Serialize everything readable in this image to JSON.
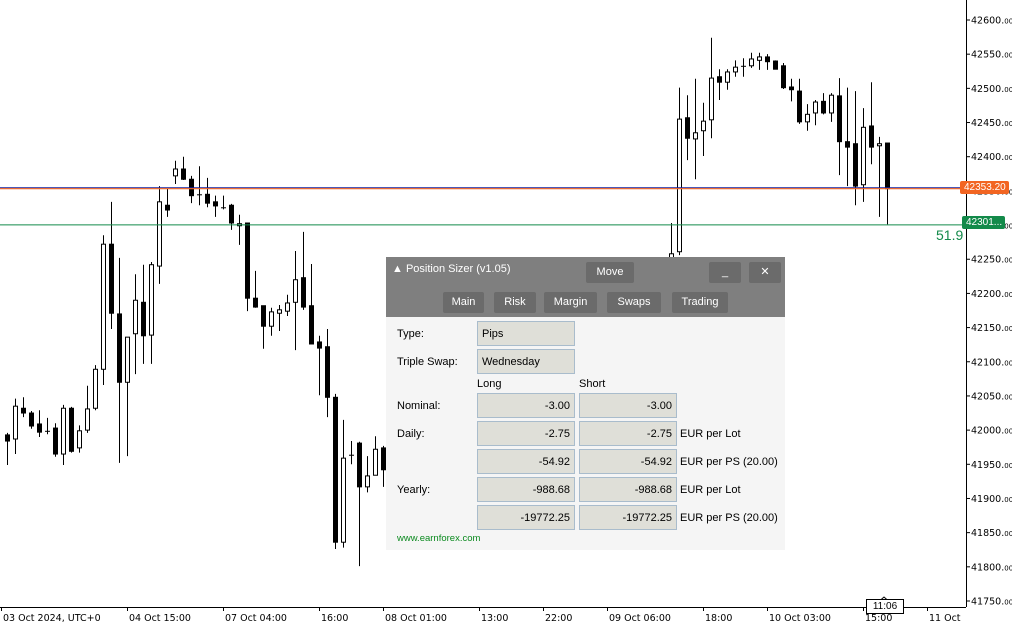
{
  "chart_data": {
    "type": "candlestick",
    "title": "",
    "ylim": [
      41740,
      42630
    ],
    "y_ticks": [
      "42600.00",
      "42550.00",
      "42500.00",
      "42450.00",
      "42400.00",
      "42350.00",
      "42300.00",
      "42250.00",
      "42200.00",
      "42150.00",
      "42100.00",
      "42050.00",
      "42000.00",
      "41950.00",
      "41900.00",
      "41850.00",
      "41800.00",
      "41750.00"
    ],
    "x_tick_labels": [
      "03 Oct 2024, UTC+0",
      "04 Oct 15:00",
      "07 Oct 04:00",
      "16:00",
      "08 Oct 01:00",
      "13:00",
      "22:00",
      "09 Oct 06:00",
      "18:00",
      "10 Oct 03:00",
      "15:00",
      "11 Oct"
    ],
    "candle_fields": [
      "open",
      "high",
      "low",
      "close"
    ],
    "bull_color": "#ffffff",
    "bear_color": "#000000",
    "candles": [
      [
        41993,
        41996,
        41949,
        41984
      ],
      [
        41987,
        42046,
        41965,
        42035
      ],
      [
        42032,
        42048,
        42019,
        42025
      ],
      [
        42025,
        42028,
        42002,
        42006
      ],
      [
        42009,
        42029,
        41990,
        41997
      ],
      [
        41999,
        42018,
        41994,
        41999
      ],
      [
        42003,
        42010,
        41961,
        41965
      ],
      [
        41965,
        42037,
        41949,
        42032
      ],
      [
        42032,
        42034,
        41967,
        41969
      ],
      [
        41974,
        42007,
        41967,
        41999
      ],
      [
        42000,
        42065,
        41996,
        42031
      ],
      [
        42032,
        42095,
        42029,
        42089
      ],
      [
        42089,
        42285,
        42066,
        42272
      ],
      [
        42272,
        42334,
        42148,
        42171
      ],
      [
        42170,
        42252,
        41952,
        42070
      ],
      [
        42070,
        42136,
        41962,
        42136
      ],
      [
        42141,
        42228,
        42082,
        42190
      ],
      [
        42187,
        42242,
        42097,
        42138
      ],
      [
        42139,
        42246,
        42097,
        42242
      ],
      [
        42240,
        42357,
        42214,
        42334
      ],
      [
        42329,
        42353,
        42312,
        42322
      ],
      [
        42372,
        42394,
        42360,
        42382
      ],
      [
        42382,
        42400,
        42366,
        42367
      ],
      [
        42367,
        42372,
        42332,
        42343
      ],
      [
        42345,
        42386,
        42329,
        42345
      ],
      [
        42345,
        42369,
        42326,
        42332
      ],
      [
        42334,
        42343,
        42312,
        42328
      ],
      [
        42326,
        42343,
        42323,
        42326
      ],
      [
        42329,
        42331,
        42293,
        42303
      ],
      [
        42299,
        42315,
        42271,
        42302
      ],
      [
        42303,
        42303,
        42174,
        42193
      ],
      [
        42193,
        42233,
        42179,
        42180
      ],
      [
        42182,
        42182,
        42119,
        42152
      ],
      [
        42152,
        42179,
        42138,
        42173
      ],
      [
        42171,
        42183,
        42145,
        42176
      ],
      [
        42174,
        42198,
        42167,
        42186
      ],
      [
        42187,
        42262,
        42117,
        42220
      ],
      [
        42223,
        42290,
        42176,
        42180
      ],
      [
        42182,
        42243,
        42126,
        42126
      ],
      [
        42129,
        42138,
        42051,
        42120
      ],
      [
        42122,
        42148,
        42019,
        42048
      ],
      [
        42048,
        42053,
        41826,
        41836
      ],
      [
        41836,
        42015,
        41828,
        41959
      ],
      [
        41964,
        41984,
        41950,
        41964
      ],
      [
        41981,
        41983,
        41801,
        41917
      ],
      [
        41917,
        41962,
        41909,
        41933
      ],
      [
        41934,
        41991,
        41934,
        41972
      ],
      [
        41974,
        41977,
        41917,
        41942
      ],
      null,
      null,
      null,
      null,
      null,
      null,
      null,
      null,
      null,
      null,
      null,
      null,
      null,
      null,
      null,
      null,
      null,
      null,
      null,
      null,
      null,
      null,
      null,
      null,
      null,
      null,
      null,
      null,
      null,
      null,
      null,
      null,
      null,
      null,
      null,
      [
        42246,
        42303,
        42242,
        42258
      ],
      [
        42261,
        42501,
        42256,
        42455
      ],
      [
        42457,
        42490,
        42395,
        42427
      ],
      [
        42426,
        42514,
        42367,
        42435
      ],
      [
        42438,
        42479,
        42401,
        42452
      ],
      [
        42454,
        42574,
        42427,
        42515
      ],
      [
        42517,
        42528,
        42483,
        42509
      ],
      [
        42509,
        42528,
        42498,
        42524
      ],
      [
        42524,
        42541,
        42517,
        42531
      ],
      [
        42533,
        42544,
        42517,
        42533
      ],
      [
        42533,
        42552,
        42530,
        42543
      ],
      [
        42541,
        42552,
        42527,
        42546
      ],
      [
        42546,
        42550,
        42527,
        42539
      ],
      [
        42540,
        42541,
        42528,
        42528
      ],
      [
        42533,
        42537,
        42499,
        42501
      ],
      [
        42502,
        42514,
        42481,
        42498
      ],
      [
        42496,
        42514,
        42448,
        42451
      ],
      [
        42451,
        42477,
        42438,
        42462
      ],
      [
        42464,
        42483,
        42446,
        42480
      ],
      [
        42481,
        42493,
        42462,
        42464
      ],
      [
        42464,
        42493,
        42451,
        42490
      ],
      [
        42489,
        42515,
        42373,
        42422
      ],
      [
        42422,
        42501,
        42357,
        42414
      ],
      [
        42419,
        42496,
        42329,
        42357
      ],
      [
        42359,
        42471,
        42334,
        42443
      ],
      [
        42445,
        42509,
        42389,
        42414
      ],
      [
        42416,
        42429,
        42312,
        42419
      ],
      [
        42420,
        42420,
        42301,
        42353.2
      ]
    ],
    "price_lines": [
      {
        "price": 42353.2,
        "label": "42353.20",
        "color": "#f26522"
      },
      {
        "price": 42301,
        "label": "42301...",
        "color": "#138a4a"
      }
    ],
    "line_annotation": "51.9",
    "current_time_label": "11:06"
  },
  "panel": {
    "title": "▲ Position Sizer (v1.05)",
    "move_label": "Move",
    "minimize_label": "_",
    "close_label": "✕",
    "tabs": [
      "Main",
      "Risk",
      "Margin",
      "Swaps",
      "Trading"
    ],
    "active_tab": "Swaps",
    "type_label": "Type:",
    "type_value": "Pips",
    "triple_label": "Triple Swap:",
    "triple_value": "Wednesday",
    "long_header": "Long",
    "short_header": "Short",
    "rows": [
      {
        "label": "Nominal:",
        "long": "-3.00",
        "short": "-3.00",
        "unit": ""
      },
      {
        "label": "Daily:",
        "long": "-2.75",
        "short": "-2.75",
        "unit": "EUR per Lot"
      },
      {
        "label": "",
        "long": "-54.92",
        "short": "-54.92",
        "unit": "EUR per PS (20.00)"
      },
      {
        "label": "Yearly:",
        "long": "-988.68",
        "short": "-988.68",
        "unit": "EUR per Lot"
      },
      {
        "label": "",
        "long": "-19772.25",
        "short": "-19772.25",
        "unit": "EUR per PS (20.00)"
      }
    ],
    "website": "www.earnforex.com"
  }
}
